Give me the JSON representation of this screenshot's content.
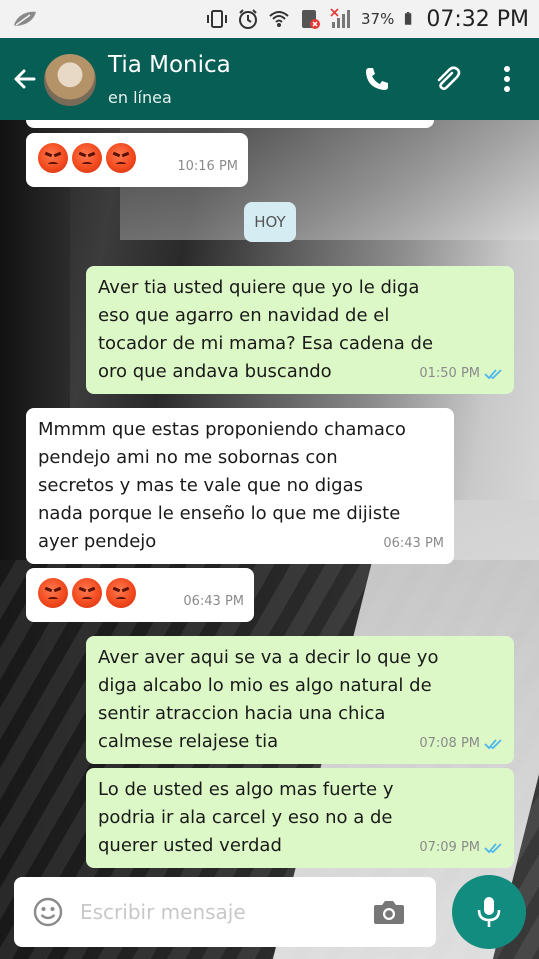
{
  "status_bar": {
    "battery_percent": "37%",
    "time": "07:32 PM"
  },
  "header": {
    "contact_name": "Tia Monica",
    "status": "en línea",
    "icons": [
      "back-arrow-icon",
      "phone-icon",
      "paperclip-icon",
      "more-vertical-icon"
    ]
  },
  "chat": {
    "date_chip": "HOY",
    "messages": [
      {
        "direction": "in",
        "text": "",
        "emoji": [
          "angry-face",
          "angry-face",
          "angry-face"
        ],
        "time": "10:16 PM"
      },
      {
        "direction": "out",
        "text": "Aver tia usted quiere que yo le diga\neso que agarro en navidad de el\ntocador de mi mama? Esa cadena de\noro que andava buscando",
        "time": "01:50 PM",
        "read": true
      },
      {
        "direction": "in",
        "text": "Mmmm que estas proponiendo chamaco\npendejo ami no me sobornas con\nsecretos y mas te vale que no digas\nnada porque le enseño lo que me dijiste\nayer pendejo",
        "time": "06:43 PM"
      },
      {
        "direction": "in",
        "text": "",
        "emoji": [
          "angry-face",
          "angry-face",
          "angry-face"
        ],
        "time": "06:43 PM"
      },
      {
        "direction": "out",
        "text": "Aver aver aqui se va a decir lo que yo\ndiga alcabo lo mio es algo natural de\nsentir atraccion hacia una chica\ncalmese relajese tia",
        "time": "07:08 PM",
        "read": true
      },
      {
        "direction": "out",
        "text": "Lo de usted es algo mas fuerte y\npodria ir ala carcel y eso no a de\nquerer usted verdad",
        "time": "07:09 PM",
        "read": true
      }
    ]
  },
  "input": {
    "placeholder": "Escribir mensaje"
  },
  "colors": {
    "header_bg": "#075e54",
    "outgoing_bubble": "#dcf8c6",
    "incoming_bubble": "#ffffff",
    "mic_button": "#128c7e",
    "read_ticks": "#4fb7ec"
  }
}
